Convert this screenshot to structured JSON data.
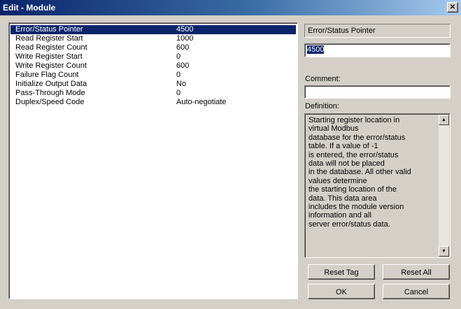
{
  "window": {
    "title": "Edit - Module",
    "close_glyph": "✕"
  },
  "parameters": [
    {
      "name": "Error/Status Pointer",
      "value": "4500",
      "selected": true
    },
    {
      "name": "Read Register Start",
      "value": "1000"
    },
    {
      "name": "Read Register Count",
      "value": "600"
    },
    {
      "name": "Write Register Start",
      "value": "0"
    },
    {
      "name": "Write Register Count",
      "value": "600"
    },
    {
      "name": "Failure Flag Count",
      "value": "0"
    },
    {
      "name": "Initialize Output Data",
      "value": "No"
    },
    {
      "name": "Pass-Through Mode",
      "value": "0"
    },
    {
      "name": "Duplex/Speed Code",
      "value": "Auto-negotiate"
    }
  ],
  "editor": {
    "selected_param": "Error/Status Pointer",
    "value": "4500",
    "comment_label": "Comment:",
    "comment_value": "",
    "definition_label": "Definition:",
    "definition_text": "Starting register location in\nvirtual Modbus\ndatabase for the error/status\ntable. If a value of -1\nis entered, the error/status\ndata will not be placed\nin the database. All other valid\nvalues determine\nthe starting location of the\ndata. This data area\nincludes the module version\ninformation and all\nserver error/status data."
  },
  "buttons": {
    "reset_tag": "Reset Tag",
    "reset_all": "Reset All",
    "ok": "OK",
    "cancel": "Cancel"
  }
}
